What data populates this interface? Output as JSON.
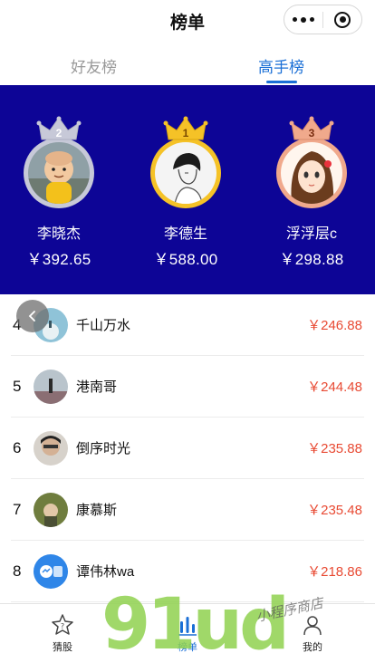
{
  "header": {
    "title": "榜单"
  },
  "tabs": [
    {
      "label": "好友榜",
      "active": false
    },
    {
      "label": "高手榜",
      "active": true
    }
  ],
  "podium": [
    {
      "rank": "2",
      "name": "李晓杰",
      "amount": "￥392.65",
      "ring_color": "#c7c9d8"
    },
    {
      "rank": "1",
      "name": "李德生",
      "amount": "￥588.00",
      "ring_color": "#f5c227"
    },
    {
      "rank": "3",
      "name": "浮浮层c",
      "amount": "￥298.88",
      "ring_color": "#f0a98c"
    }
  ],
  "list": [
    {
      "rank": "4",
      "name": "千山万水",
      "amount": "￥246.88"
    },
    {
      "rank": "5",
      "name": "港南哥",
      "amount": "￥244.48"
    },
    {
      "rank": "6",
      "name": "倒序时光",
      "amount": "￥235.88"
    },
    {
      "rank": "7",
      "name": "康慕斯",
      "amount": "￥235.48"
    },
    {
      "rank": "8",
      "name": "谭伟林wa",
      "amount": "￥218.86"
    }
  ],
  "tabbar": [
    {
      "label": "猜股",
      "icon": "star-question-icon",
      "active": false
    },
    {
      "label": "榜单",
      "icon": "bars-icon",
      "active": true
    },
    {
      "label": "我的",
      "icon": "user-icon",
      "active": false
    }
  ],
  "watermark": {
    "logo_text": "91ud",
    "script_text": "小程序商店"
  },
  "colors": {
    "accent": "#1a6fd6",
    "podium_bg": "#0d0596",
    "amount": "#e84a33"
  }
}
